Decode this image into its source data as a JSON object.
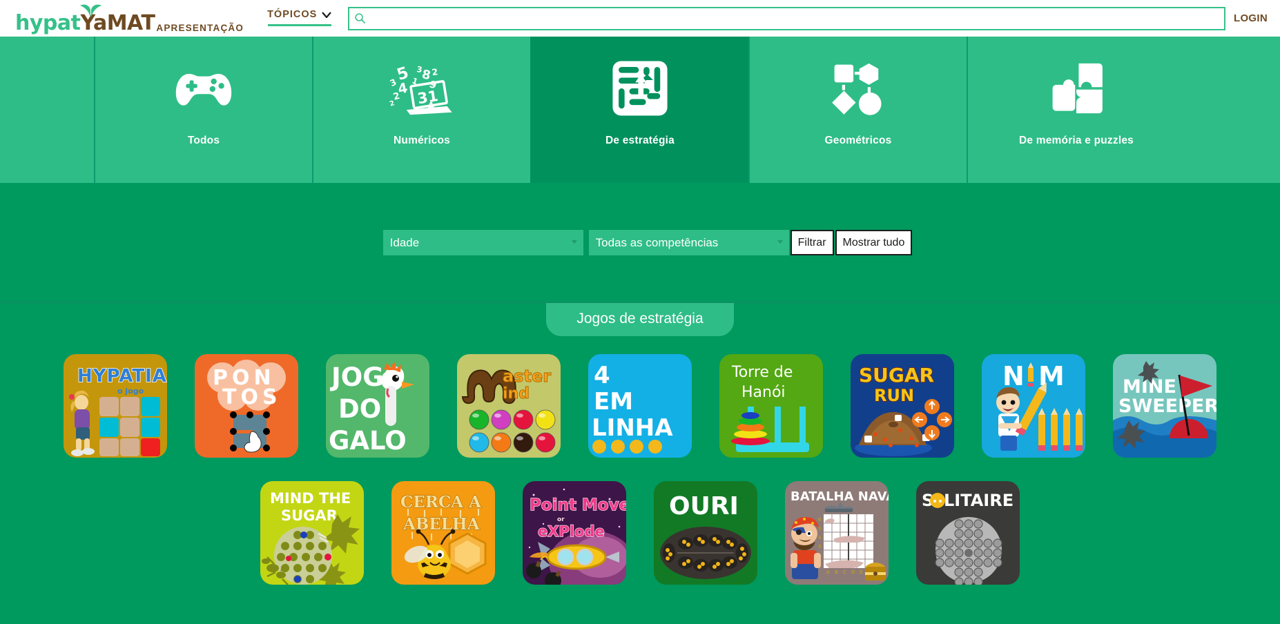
{
  "header": {
    "logo_hypat": "hypat",
    "logo_yamat": "YaMAT",
    "logo_subtitle": "APRESENTAÇÃO",
    "topics_label": "TÓPICOS",
    "search_value": "",
    "search_placeholder": "",
    "login_label": "LOGIN",
    "brand_green": "#35c189",
    "brand_brown": "#6e4a22"
  },
  "categories": [
    {
      "label": "Todos",
      "icon": "gamepad-icon",
      "active": false
    },
    {
      "label": "Numéricos",
      "icon": "laptop-numbers-icon",
      "active": false
    },
    {
      "label": "De estratégia",
      "icon": "maze-arrows-icon",
      "active": true
    },
    {
      "label": "Geométricos",
      "icon": "shapes-network-icon",
      "active": false
    },
    {
      "label": "De memória e puzzles",
      "icon": "puzzle-pieces-icon",
      "active": false
    }
  ],
  "filters": {
    "age_label": "Idade",
    "age_options": [
      "Idade"
    ],
    "competence_label": "Todas as competências",
    "competence_options": [
      "Todas as competências"
    ],
    "filter_button": "Filtrar",
    "show_all_button": "Mostrar tudo"
  },
  "section": {
    "title": "Jogos de estratégia"
  },
  "games_row1": [
    {
      "name": "Hypatia o jogo",
      "title": "HYPATIA",
      "subtitle": "o jogo",
      "bg": "#c4960c"
    },
    {
      "name": "Pontos",
      "title": "PONTOS",
      "bg": "#ef6a28"
    },
    {
      "name": "Jogo do Galo",
      "title": "JOGO DO GALO",
      "bg": "#53b86b"
    },
    {
      "name": "Master Mind",
      "title": "Master Mind",
      "bg": "#c3c86a"
    },
    {
      "name": "4 em Linha",
      "title": "4 EM LINHA",
      "bg": "#13b0e6"
    },
    {
      "name": "Torre de Hanói",
      "title": "Torre de Hanói",
      "bg": "#53a813"
    },
    {
      "name": "Sugar Run",
      "title": "SUGAR RUN",
      "bg": "#123f8c"
    },
    {
      "name": "NIM",
      "title": "NIM",
      "bg": "#17a8dd"
    },
    {
      "name": "Mine Sweeper",
      "title": "MINE SWEEPER",
      "bg": "#76c6bd"
    }
  ],
  "games_row2": [
    {
      "name": "Mind the Sugar",
      "title": "MIND THE SUGAR",
      "bg": "#c3d614"
    },
    {
      "name": "Cerca a Abelha",
      "title": "CERCA A ABELHA",
      "bg": "#f59b11"
    },
    {
      "name": "Point Move or eXPlode",
      "title": "Point Move or eXPlode",
      "bg": "#4a1b55"
    },
    {
      "name": "Ouri",
      "title": "OURI",
      "bg": "#127a25"
    },
    {
      "name": "Batalha Naval",
      "title": "BATALHA NAVAL",
      "bg": "#8e7b78"
    },
    {
      "name": "Solitaire",
      "title": "SOLITAIRE",
      "bg": "#3a3a38"
    }
  ]
}
